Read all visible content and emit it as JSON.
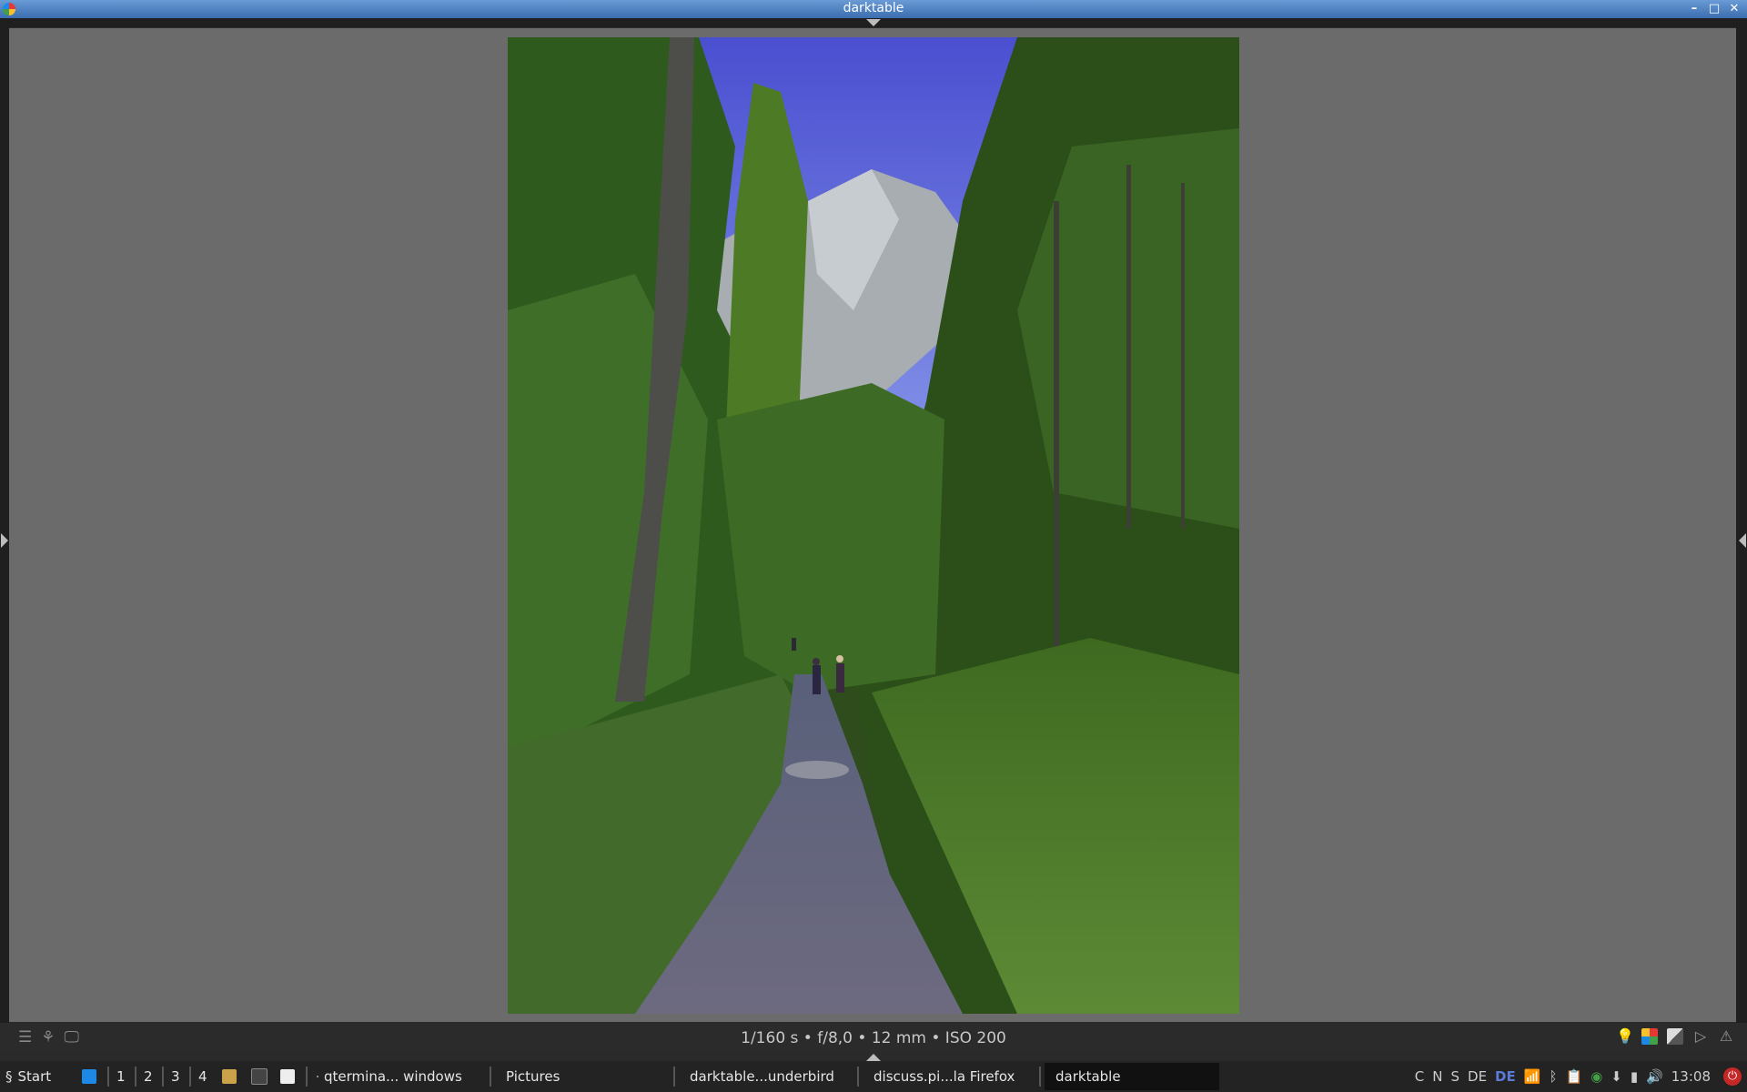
{
  "window": {
    "title": "darktable"
  },
  "image_info": {
    "exposure": "1/160 s • f/8,0 • 12 mm • ISO 200"
  },
  "taskbar": {
    "start_label": "Start",
    "workspaces": [
      "1",
      "2",
      "3",
      "4"
    ],
    "tasks": [
      {
        "label": "qtermina... windows",
        "icon": "terminal-icon"
      },
      {
        "label": "Pictures",
        "icon": "folder-icon"
      },
      {
        "label": "darktable...underbird",
        "icon": "thunderbird-icon"
      },
      {
        "label": "discuss.pi...la Firefox",
        "icon": "firefox-icon"
      },
      {
        "label": "darktable",
        "icon": "darktable-icon",
        "active": true
      }
    ],
    "tray_letters": [
      "C",
      "N",
      "S",
      "DE"
    ],
    "keyboard_layout": "DE",
    "clock": "13:08"
  },
  "colors": {
    "accent": "#3b6db0",
    "background": "#6b6b6b"
  }
}
